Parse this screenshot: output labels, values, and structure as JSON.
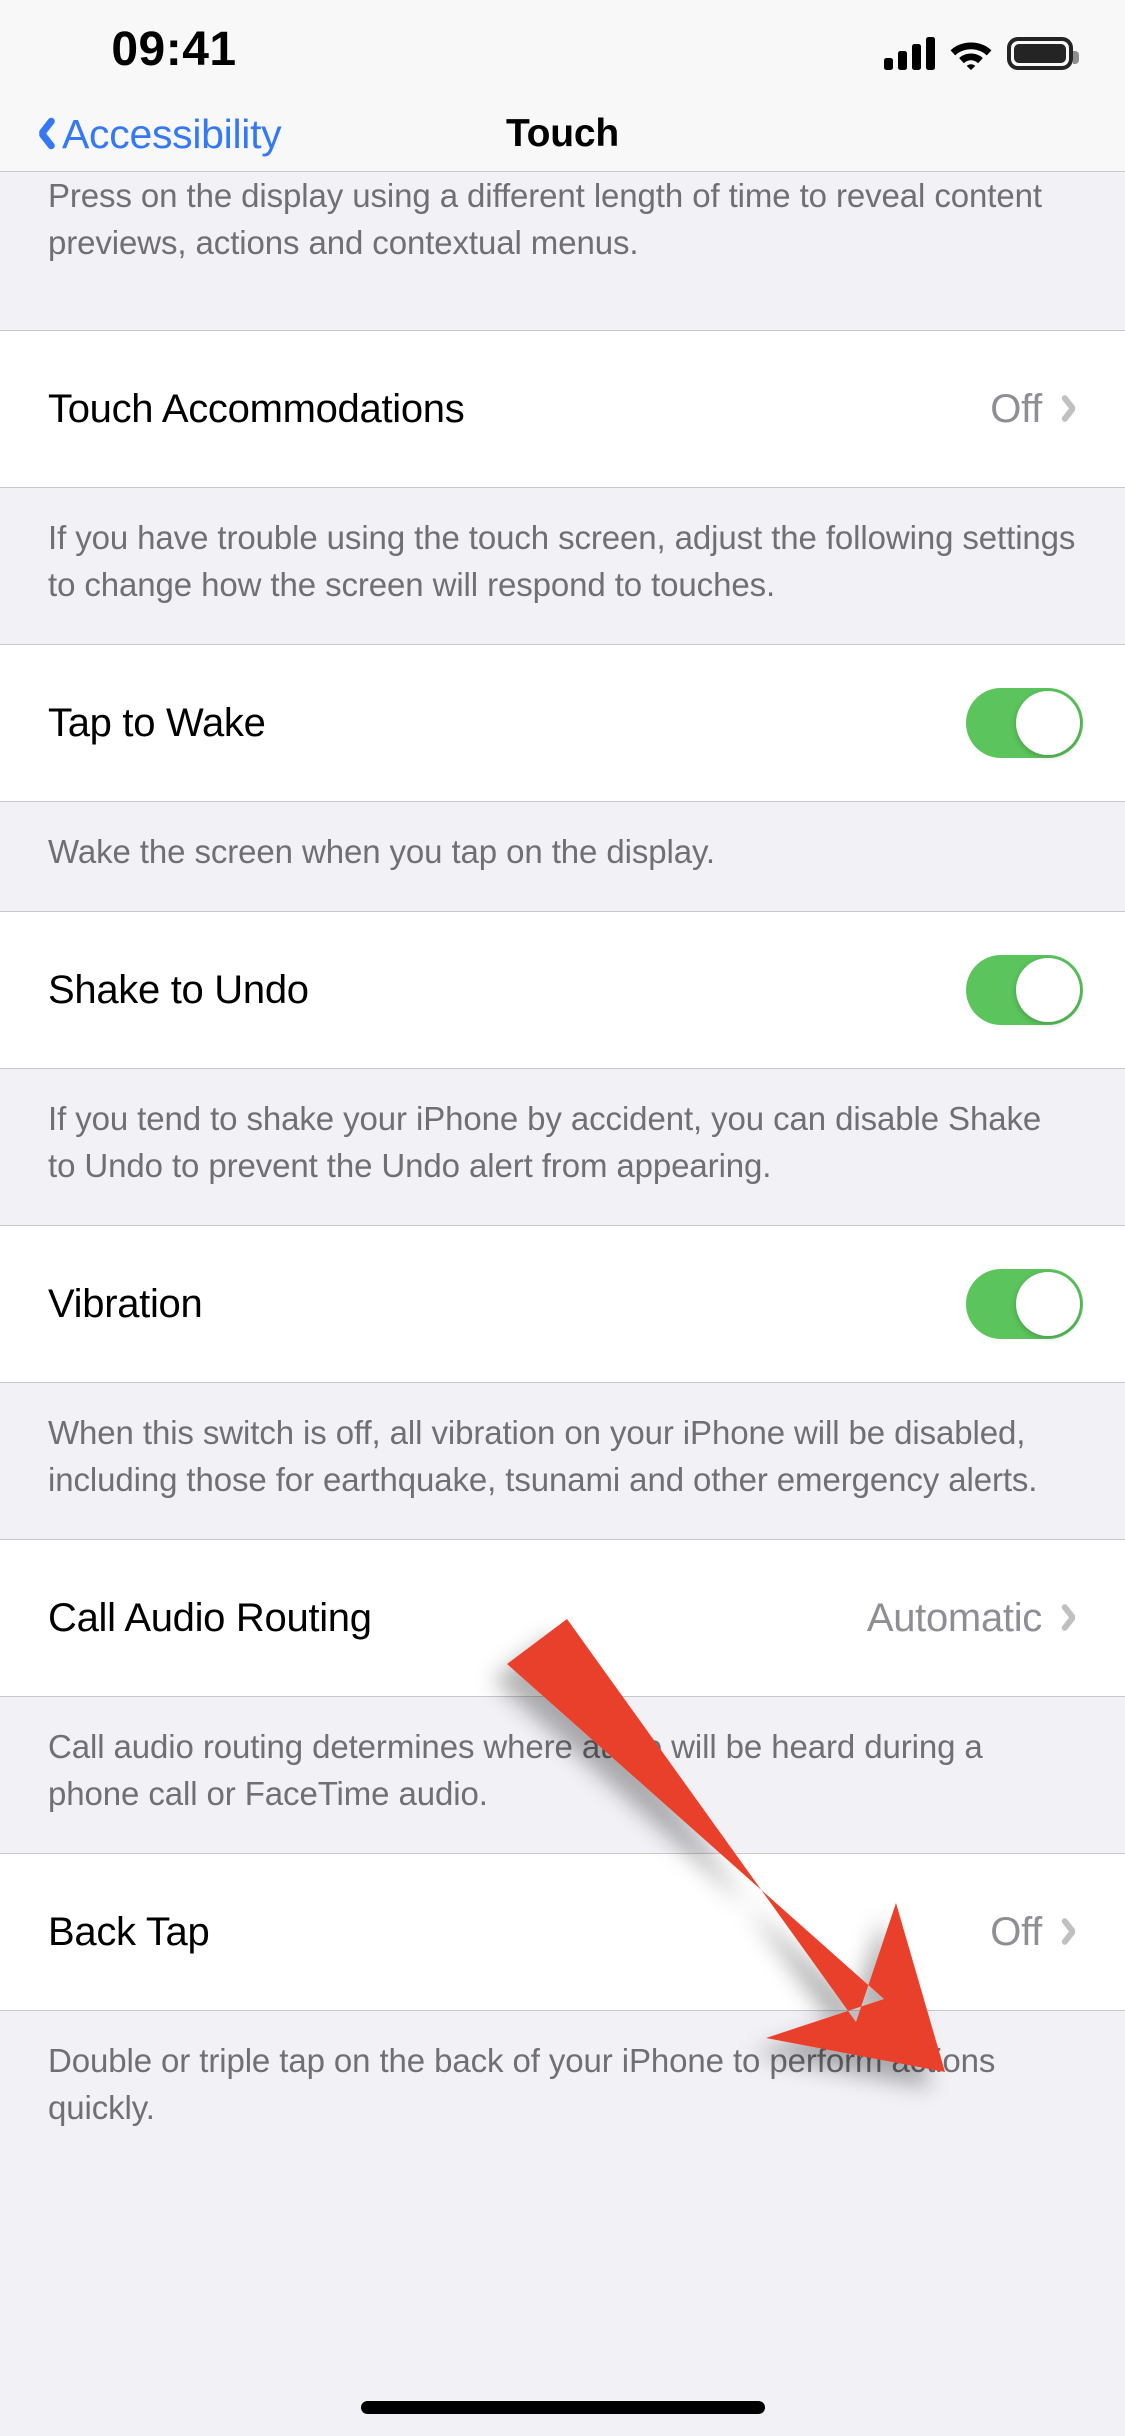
{
  "status_bar": {
    "time": "09:41",
    "signal_icon": "cellular-signal-icon",
    "signal_bars": 4,
    "wifi_icon": "wifi-icon",
    "battery_icon": "battery-full-icon"
  },
  "nav_bar": {
    "back_label": "Accessibility",
    "back_icon": "chevron-left-icon",
    "title": "Touch"
  },
  "sections": [
    {
      "footer_top_clipped": "Press on the display using a different length of time to reveal content previews, actions and contextual menus."
    }
  ],
  "rows": [
    {
      "name": "touch-accommodations",
      "label": "Touch Accommodations",
      "type": "disclosure",
      "value": "Off",
      "chevron_icon": "chevron-right-icon",
      "footer": "If you have trouble using the touch screen, adjust the following settings to change how the screen will respond to touches."
    },
    {
      "name": "tap-to-wake",
      "label": "Tap to Wake",
      "type": "toggle",
      "value": "on",
      "footer": "Wake the screen when you tap on the display."
    },
    {
      "name": "shake-to-undo",
      "label": "Shake to Undo",
      "type": "toggle",
      "value": "on",
      "footer": "If you tend to shake your iPhone by accident, you can disable Shake to Undo to prevent the Undo alert from appearing."
    },
    {
      "name": "vibration",
      "label": "Vibration",
      "type": "toggle",
      "value": "on",
      "footer": "When this switch is off, all vibration on your iPhone will be disabled, including those for earthquake, tsunami and other emergency alerts."
    },
    {
      "name": "call-audio-routing",
      "label": "Call Audio Routing",
      "type": "disclosure",
      "value": "Automatic",
      "chevron_icon": "chevron-right-icon",
      "footer": "Call audio routing determines where audio will be heard during a phone call or FaceTime audio."
    },
    {
      "name": "back-tap",
      "label": "Back Tap",
      "type": "disclosure",
      "value": "Off",
      "chevron_icon": "chevron-right-icon",
      "footer": "Double or triple tap on the back of your iPhone to perform actions quickly."
    }
  ],
  "annotation": {
    "type": "arrow",
    "icon": "red-arrow-annotation",
    "color": "#e8402a",
    "points_to": "back-tap-value"
  },
  "colors": {
    "accent_blue": "#3478f6",
    "toggle_on_green": "#5bc45c",
    "value_gray": "#8e8e93",
    "footer_gray": "#6f6f74",
    "group_background": "#f1f1f6",
    "cell_background": "#ffffff",
    "separator": "#c9c9cd",
    "annotation_red": "#e8402a"
  },
  "home_indicator": "home-indicator"
}
